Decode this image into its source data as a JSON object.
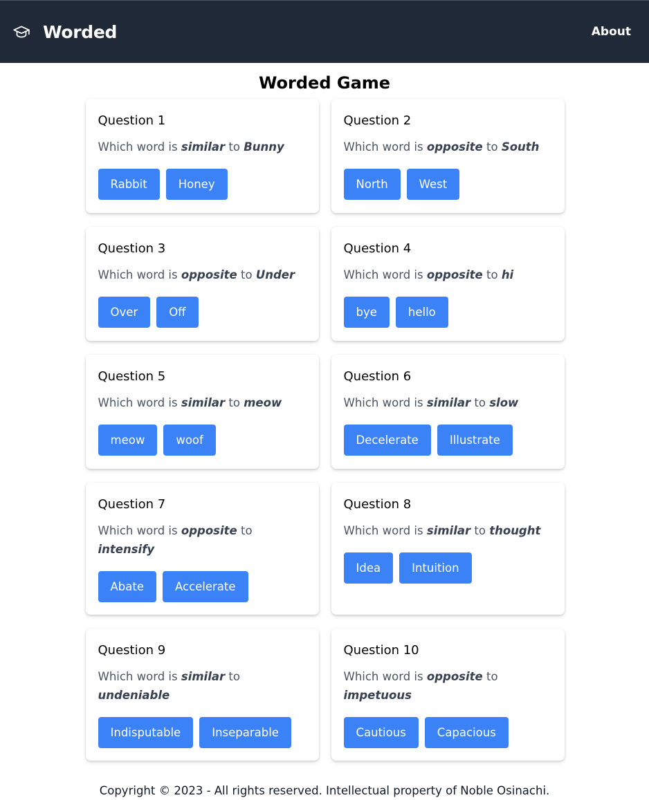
{
  "nav": {
    "brand": "Worded",
    "brand_icon": "graduation-cap-icon",
    "about": "About"
  },
  "page": {
    "title": "Worded Game"
  },
  "question_prefix": "Which word is",
  "questions": [
    {
      "title": "Question 1",
      "relation": "similar",
      "connector": "to",
      "word": "Bunny",
      "options": [
        "Rabbit",
        "Honey"
      ]
    },
    {
      "title": "Question 2",
      "relation": "opposite",
      "connector": "to",
      "word": "South",
      "options": [
        "North",
        "West"
      ]
    },
    {
      "title": "Question 3",
      "relation": "opposite",
      "connector": "to",
      "word": "Under",
      "options": [
        "Over",
        "Off"
      ]
    },
    {
      "title": "Question 4",
      "relation": "opposite",
      "connector": "to",
      "word": "hi",
      "options": [
        "bye",
        "hello"
      ]
    },
    {
      "title": "Question 5",
      "relation": "similar",
      "connector": "to",
      "word": "meow",
      "options": [
        "meow",
        "woof"
      ]
    },
    {
      "title": "Question 6",
      "relation": "similar",
      "connector": "to",
      "word": "slow",
      "options": [
        "Decelerate",
        "Illustrate"
      ]
    },
    {
      "title": "Question 7",
      "relation": "opposite",
      "connector": "to",
      "word": "intensify",
      "options": [
        "Abate",
        "Accelerate"
      ]
    },
    {
      "title": "Question 8",
      "relation": "similar",
      "connector": "to",
      "word": "thought",
      "options": [
        "Idea",
        "Intuition"
      ]
    },
    {
      "title": "Question 9",
      "relation": "similar",
      "connector": "to",
      "word": "undeniable",
      "options": [
        "Indisputable",
        "Inseparable"
      ]
    },
    {
      "title": "Question 10",
      "relation": "opposite",
      "connector": "to",
      "word": "impetuous",
      "options": [
        "Cautious",
        "Capacious"
      ]
    }
  ],
  "footer": {
    "text": "Copyright © 2023 - All rights reserved. Intellectual property of Noble Osinachi."
  },
  "colors": {
    "navbar": "#1f2937",
    "button": "#3b82f6"
  }
}
